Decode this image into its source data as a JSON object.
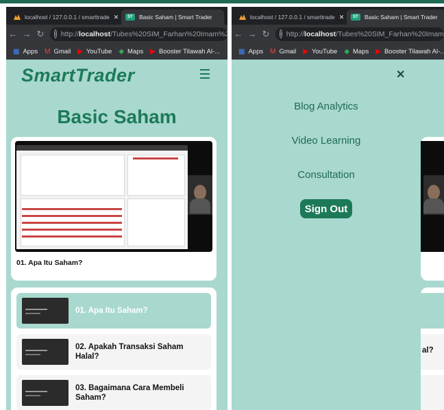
{
  "browser": {
    "inactive_tab_title": "localhost / 127.0.0.1 / smarttrade",
    "active_tab_title": "Basic Saham | Smart Trader",
    "active_tab_favicon": "ST",
    "url_prefix": "http://",
    "url_host": "localhost",
    "url_path": "/Tubes%20SIM_Farhan%20Imam%20",
    "bookmarks": [
      {
        "label": "Apps",
        "icon": "apps-grid-icon",
        "color": "#4285f4"
      },
      {
        "label": "Gmail",
        "icon": "gmail-icon",
        "color": "#ea4335"
      },
      {
        "label": "YouTube",
        "icon": "youtube-icon",
        "color": "#ff0000"
      },
      {
        "label": "Maps",
        "icon": "maps-icon",
        "color": "#34a853"
      },
      {
        "label": "Booster Tilawah Al-...",
        "icon": "youtube-icon",
        "color": "#ff0000"
      }
    ]
  },
  "site": {
    "brand": "SmartTrader",
    "page_title": "Basic Saham",
    "current_video_title": "01. Apa Itu Saham?",
    "playlist": [
      {
        "label": "01. Apa Itu Saham?",
        "active": true
      },
      {
        "label": "02. Apakah Transaksi Saham Halal?",
        "active": false
      },
      {
        "label": "03. Bagaimana Cara Membeli Saham?",
        "active": false
      }
    ],
    "visible_partial_text": "al?"
  },
  "menu": {
    "close_icon": "close-icon",
    "items": [
      "Blog Analytics",
      "Video Learning",
      "Consultation"
    ],
    "sign_out": "Sign Out"
  },
  "colors": {
    "accent": "#1d7a59",
    "page_bg": "#a9d8cf",
    "browser_dark": "#202124",
    "browser_toolbar": "#35363a"
  }
}
